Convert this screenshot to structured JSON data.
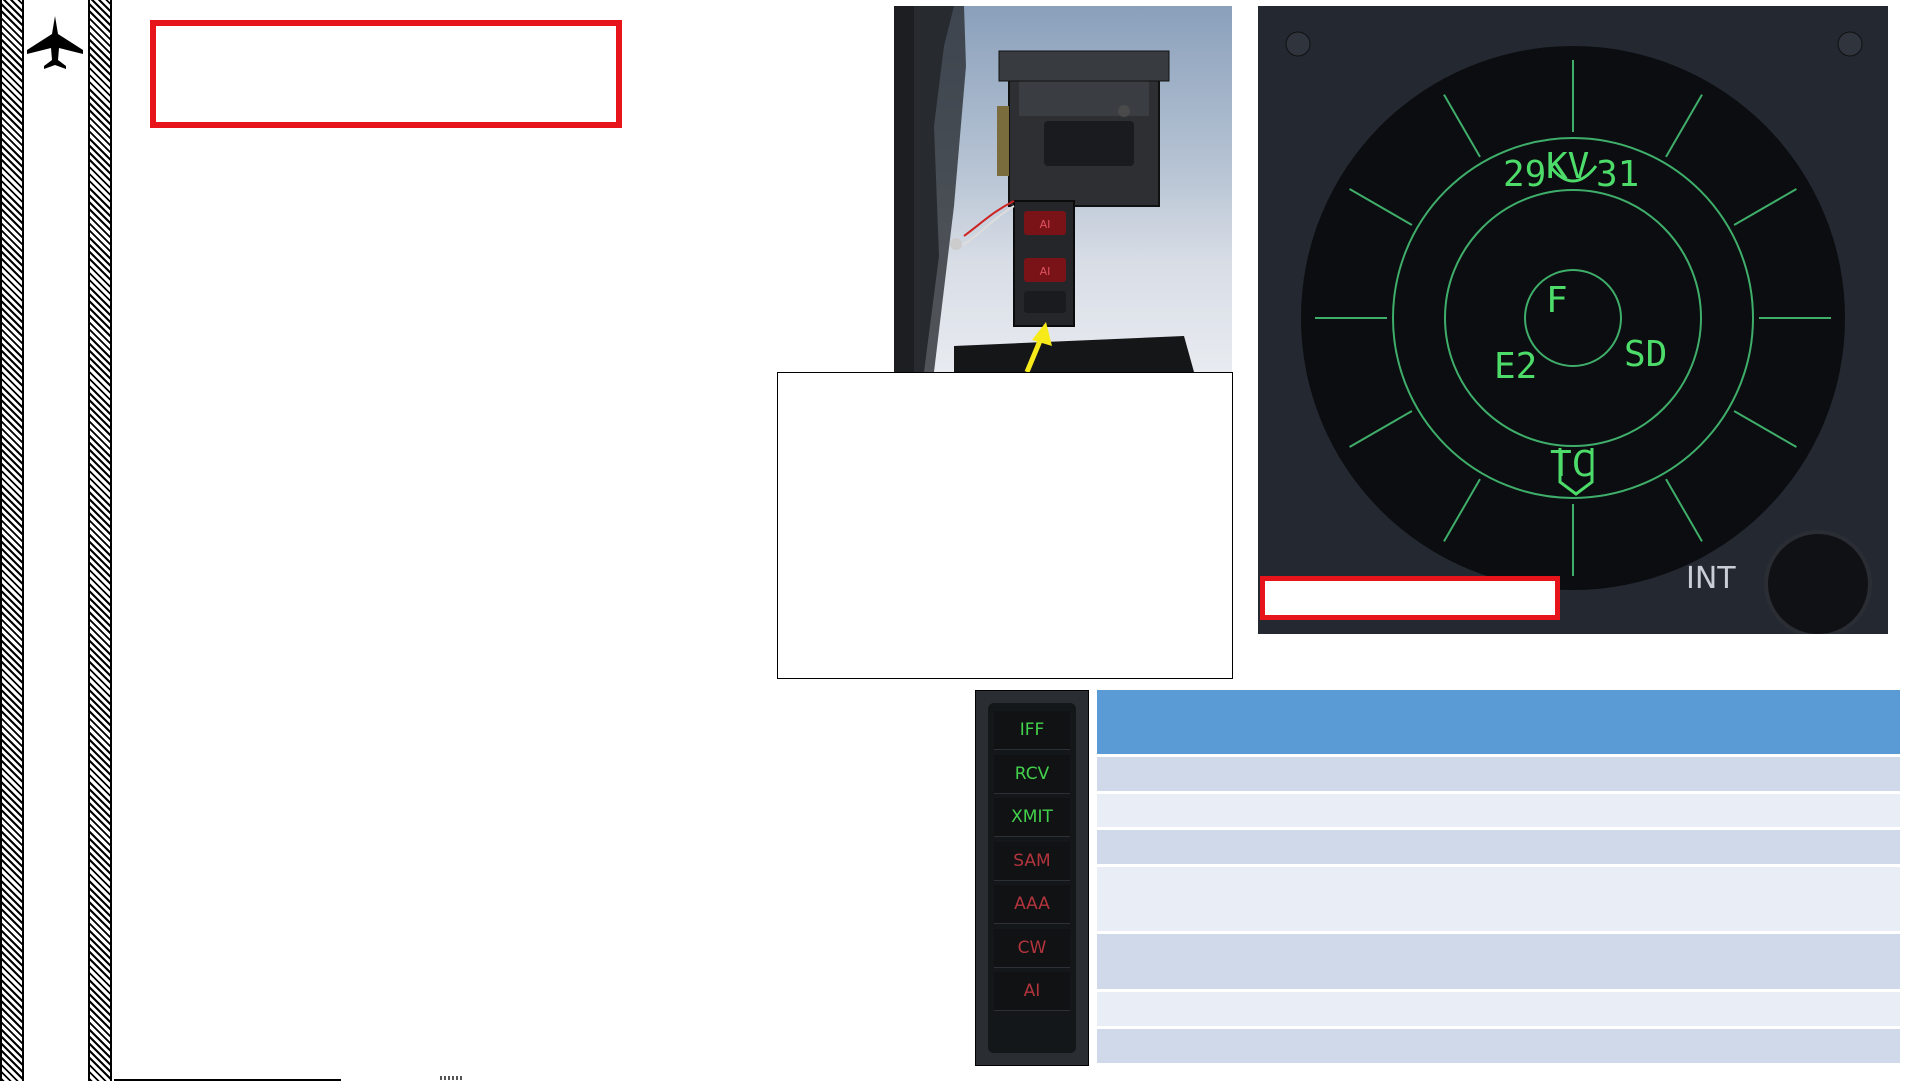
{
  "rwr_display": {
    "symbols": [
      "29",
      "KV",
      "31",
      "F",
      "E2",
      "SD",
      "TC"
    ],
    "int_label": "INT"
  },
  "threat_panel": {
    "lamps": [
      {
        "label": "IFF",
        "color": "green"
      },
      {
        "label": "RCV",
        "color": "green"
      },
      {
        "label": "XMIT",
        "color": "green"
      },
      {
        "label": "SAM",
        "color": "red"
      },
      {
        "label": "AAA",
        "color": "red"
      },
      {
        "label": "CW",
        "color": "red"
      },
      {
        "label": "AI",
        "color": "red"
      }
    ]
  },
  "cockpit_photo": {
    "lamp_labels": [
      "AI",
      "AI"
    ]
  },
  "colors": {
    "accent_red": "#e8141b",
    "table_header": "#5b9bd5",
    "table_row_dark": "#cfd9ea",
    "table_row_light": "#e9edf6",
    "rwr_symbol_green": "#4ddc6a",
    "arrow_yellow": "#f6ea1a"
  },
  "icons": {
    "logo": "fighter-jet-icon",
    "pointer": "yellow-arrow-icon"
  }
}
